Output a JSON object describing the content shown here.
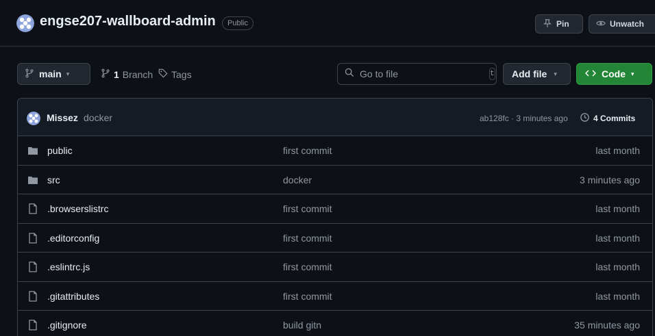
{
  "repo": {
    "name": "engse207-wallboard-admin",
    "visibility": "Public"
  },
  "header_actions": {
    "pin_label": "Pin",
    "watch_label": "Unwatch"
  },
  "toolbar": {
    "branch_name": "main",
    "branch_count": "1",
    "branch_label": "Branch",
    "tags_label": "Tags",
    "search_placeholder": "Go to file",
    "search_shortcut": "t",
    "add_file_label": "Add file",
    "code_label": "Code"
  },
  "latest_commit": {
    "author": "Missez",
    "message": "docker",
    "meta": "ab128fc · 3 minutes ago",
    "commits_label": "4 Commits"
  },
  "files": [
    {
      "name": "public",
      "type": "folder",
      "commit": "first commit",
      "date": "last month"
    },
    {
      "name": "src",
      "type": "folder",
      "commit": "docker",
      "date": "3 minutes ago"
    },
    {
      "name": ".browserslistrc",
      "type": "file",
      "commit": "first commit",
      "date": "last month"
    },
    {
      "name": ".editorconfig",
      "type": "file",
      "commit": "first commit",
      "date": "last month"
    },
    {
      "name": ".eslintrc.js",
      "type": "file",
      "commit": "first commit",
      "date": "last month"
    },
    {
      "name": ".gitattributes",
      "type": "file",
      "commit": "first commit",
      "date": "last month"
    },
    {
      "name": ".gitignore",
      "type": "file",
      "commit": "build gitn",
      "date": "35 minutes ago"
    }
  ],
  "colors": {
    "background": "#0d1117",
    "border": "#3d444d",
    "code_button": "#238636",
    "text_primary": "#e6edf3",
    "text_muted": "#9198a1",
    "avatar": "#8ea4dc"
  },
  "icons": {
    "avatar": "identicon-avatar",
    "pin": "pin-icon",
    "watch": "eye-icon",
    "branch": "git-branch-icon",
    "tag": "tag-icon",
    "search": "search-icon",
    "code": "code-icon",
    "history": "history-icon",
    "folder": "folder-icon",
    "file": "file-icon"
  }
}
